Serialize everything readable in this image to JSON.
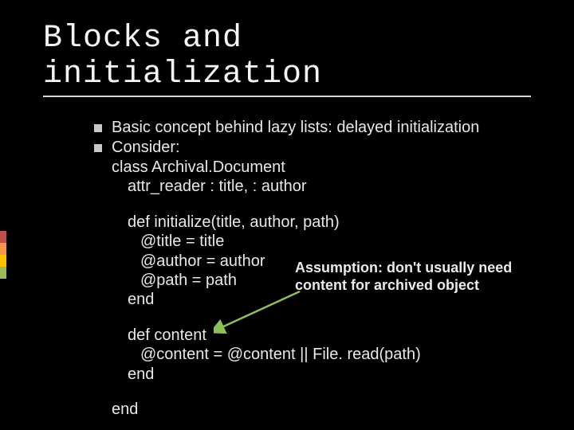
{
  "title": "Blocks and initialization",
  "bullets": [
    "Basic concept behind lazy lists: delayed initialization",
    "Consider:"
  ],
  "code": {
    "l1": "class Archival.Document",
    "l2": "attr_reader : title, : author",
    "l3": "def initialize(title, author, path)",
    "l4": "@title = title",
    "l5": "@author = author",
    "l6": "@path = path",
    "l7": "end",
    "l8": "def content",
    "l9": "@content = @content || File. read(path)",
    "l10": "end",
    "l11": "end"
  },
  "assumption": {
    "line1": "Assumption: don't usually need",
    "line2": "content for archived object"
  },
  "accent_colors": [
    "#c0504d",
    "#f79646",
    "#ffc000",
    "#9bbb59"
  ]
}
